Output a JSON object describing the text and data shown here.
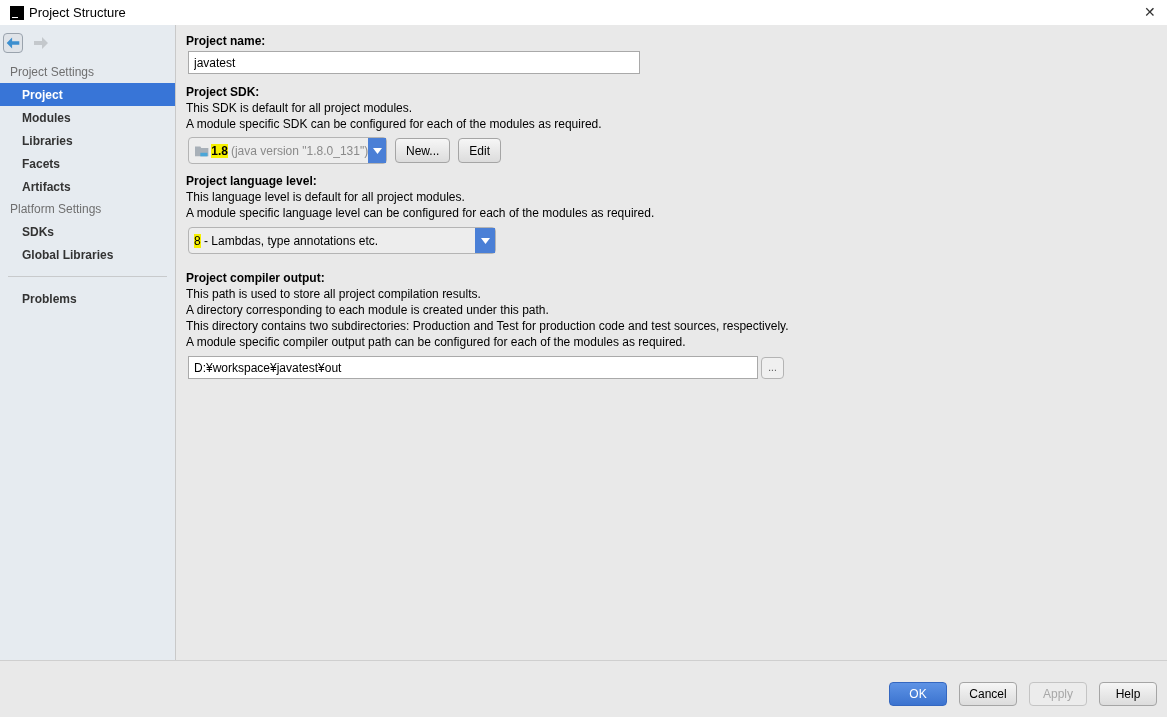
{
  "window": {
    "title": "Project Structure",
    "close": "✕"
  },
  "nav": {
    "back_enabled": true,
    "forward_enabled": false
  },
  "sidebar": {
    "sections": [
      {
        "title": "Project Settings",
        "items": [
          {
            "label": "Project",
            "selected": true
          },
          {
            "label": "Modules",
            "selected": false
          },
          {
            "label": "Libraries",
            "selected": false
          },
          {
            "label": "Facets",
            "selected": false
          },
          {
            "label": "Artifacts",
            "selected": false
          }
        ]
      },
      {
        "title": "Platform Settings",
        "items": [
          {
            "label": "SDKs",
            "selected": false
          },
          {
            "label": "Global Libraries",
            "selected": false
          }
        ]
      }
    ],
    "bottom_items": [
      {
        "label": "Problems",
        "selected": false
      }
    ]
  },
  "project_name": {
    "label": "Project name:",
    "value": "javatest"
  },
  "project_sdk": {
    "label": "Project SDK:",
    "description": [
      "This SDK is default for all project modules.",
      "A module specific SDK can be configured for each of the modules as required."
    ],
    "version": "1.8",
    "version_highlighted": true,
    "detail": "(java version \"1.8.0_131\")",
    "buttons": [
      {
        "label": "New..."
      },
      {
        "label": "Edit"
      }
    ]
  },
  "language_level": {
    "label": "Project language level:",
    "description": [
      "This language level is default for all project modules.",
      "A module specific language level can be configured for each of the modules as required."
    ],
    "number": "8",
    "number_highlighted": true,
    "text": " - Lambdas, type annotations etc."
  },
  "compiler_output": {
    "label": "Project compiler output:",
    "description": [
      "This path is used to store all project compilation results.",
      "A directory corresponding to each module is created under this path.",
      "This directory contains two subdirectories: Production and Test for production code and test sources, respectively.",
      "A module specific compiler output path can be configured for each of the modules as required."
    ],
    "value": "D:¥workspace¥javatest¥out",
    "browse": "..."
  },
  "footer": {
    "buttons": [
      {
        "label": "OK",
        "kind": "primary",
        "disabled": false
      },
      {
        "label": "Cancel",
        "kind": "normal",
        "disabled": false
      },
      {
        "label": "Apply",
        "kind": "normal",
        "disabled": true
      },
      {
        "label": "Help",
        "kind": "normal",
        "disabled": false
      }
    ]
  }
}
